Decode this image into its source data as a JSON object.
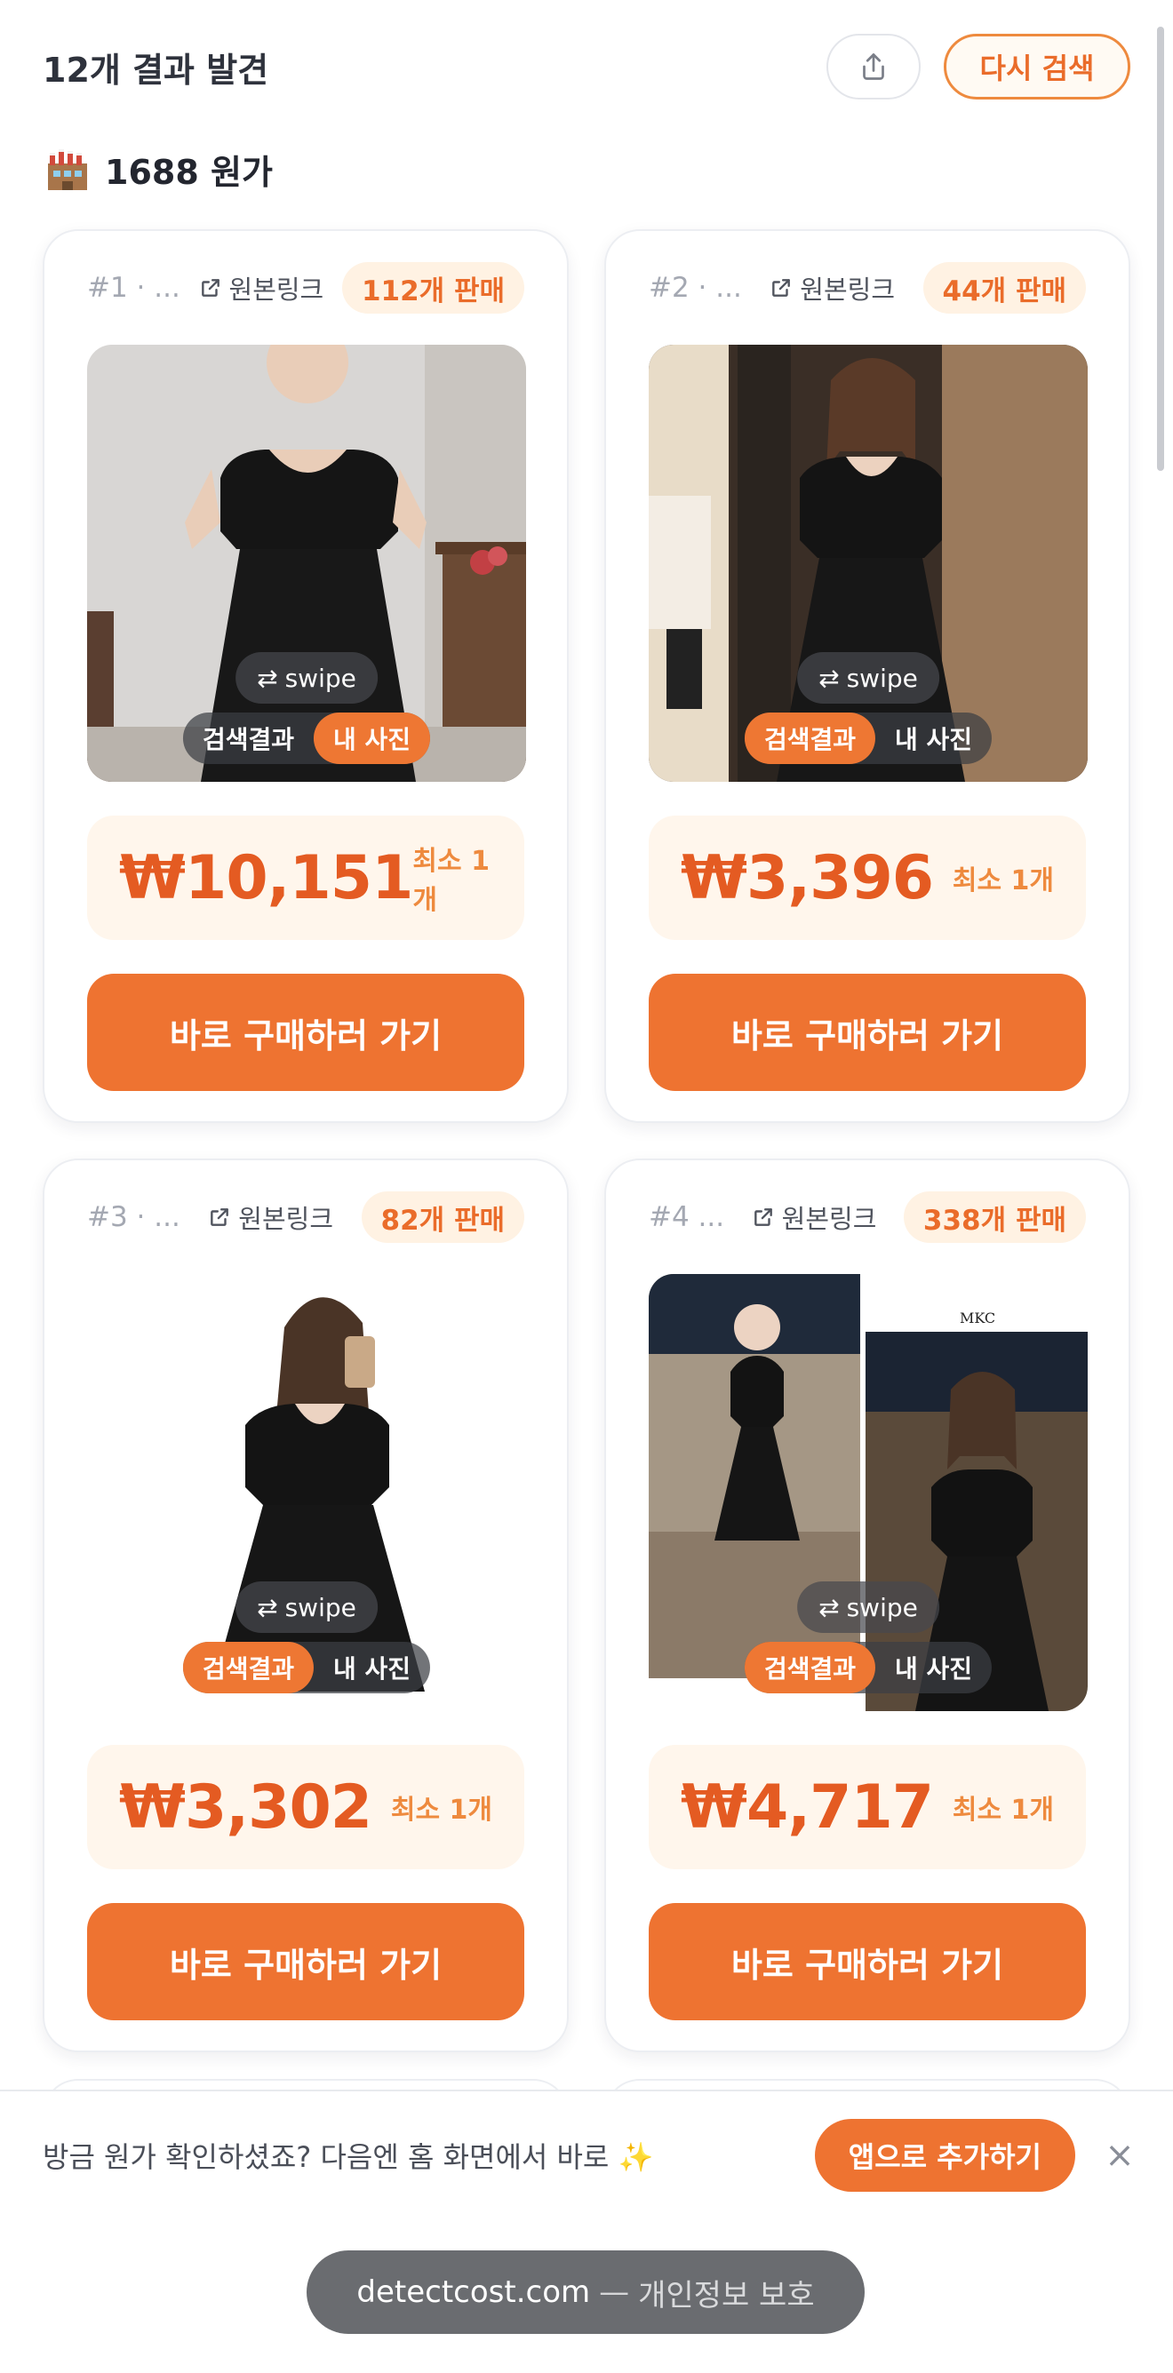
{
  "header": {
    "result_count": "12개 결과 발견",
    "share_icon": "share-icon",
    "research_label": "다시 검색"
  },
  "section": {
    "icon": "factory-icon",
    "title": "1688 원가"
  },
  "colors": {
    "accent": "#EE7331",
    "price": "#E45B22",
    "badge_bg": "#FFF2E3",
    "price_bg": "#FFF6EC"
  },
  "cards": [
    {
      "rank": "#1 · ...",
      "link_label": "원본링크",
      "sold": "112개 판매",
      "swipe": "swipe",
      "toggle_search": "검색결과",
      "toggle_mine": "내 사진",
      "active_toggle": "mine",
      "price": "₩10,151",
      "moq": "최소 1개",
      "buy_label": "바로 구매하러 가기"
    },
    {
      "rank": "#2 · ...",
      "link_label": "원본링크",
      "sold": "44개 판매",
      "swipe": "swipe",
      "toggle_search": "검색결과",
      "toggle_mine": "내 사진",
      "active_toggle": "search",
      "price": "₩3,396",
      "moq": "최소 1개",
      "buy_label": "바로 구매하러 가기"
    },
    {
      "rank": "#3 · ...",
      "link_label": "원본링크",
      "sold": "82개 판매",
      "swipe": "swipe",
      "toggle_search": "검색결과",
      "toggle_mine": "내 사진",
      "active_toggle": "search",
      "price": "₩3,302",
      "moq": "최소 1개",
      "buy_label": "바로 구매하러 가기"
    },
    {
      "rank": "#4 ...",
      "link_label": "원본링크",
      "sold": "338개 판매",
      "swipe": "swipe",
      "toggle_search": "검색결과",
      "toggle_mine": "내 사진",
      "active_toggle": "search",
      "price": "₩4,717",
      "moq": "최소 1개",
      "buy_label": "바로 구매하러 가기",
      "image_watermark": "MKC"
    }
  ],
  "banner": {
    "text": "방금 원가 확인하셨죠? 다음엔 홈 화면에서 바로 ✨",
    "add_label": "앱으로 추가하기",
    "close": "×"
  },
  "footer": {
    "domain": "detectcost.com",
    "sep": "—",
    "privacy": "개인정보 보호"
  }
}
